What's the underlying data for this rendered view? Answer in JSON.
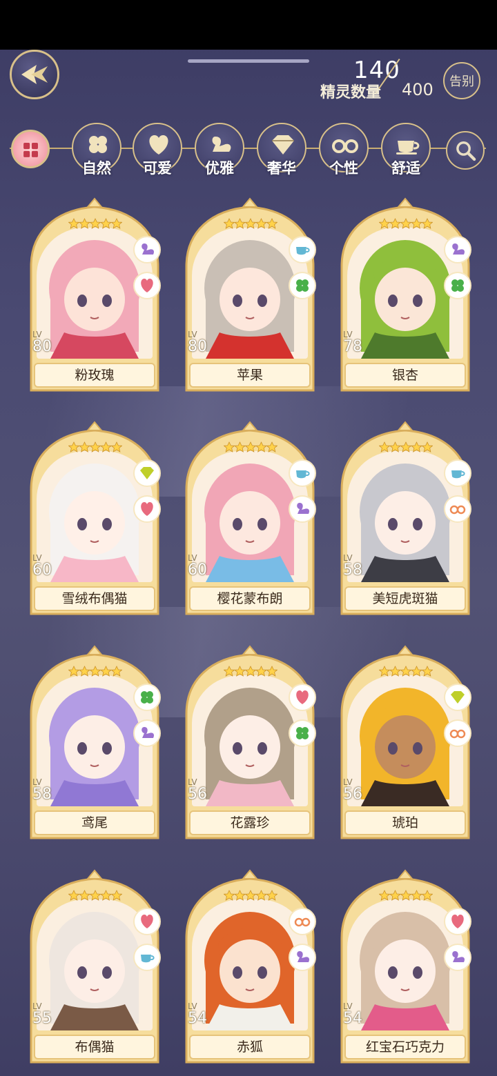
{
  "header": {
    "count_current": "140",
    "count_label": "精灵数量",
    "count_max": "400",
    "goodbye_label": "告别"
  },
  "filters": [
    {
      "key": "all",
      "label": "",
      "icon": "grid-icon"
    },
    {
      "key": "nature",
      "label": "自然",
      "icon": "clover-icon"
    },
    {
      "key": "cute",
      "label": "可爱",
      "icon": "heart-icon"
    },
    {
      "key": "elegant",
      "label": "优雅",
      "icon": "swan-icon"
    },
    {
      "key": "luxury",
      "label": "奢华",
      "icon": "diamond-icon"
    },
    {
      "key": "personality",
      "label": "个性",
      "icon": "glasses-icon"
    },
    {
      "key": "comfort",
      "label": "舒适",
      "icon": "teacup-icon"
    }
  ],
  "colors": {
    "accent_gold": "#d8c08a",
    "nature": "#49b04a",
    "cute": "#e86a7e",
    "elegant": "#9a71cf",
    "luxury": "#bfcf2a",
    "personality": "#ee8a55",
    "comfort": "#62b7d4"
  },
  "cards": [
    {
      "name": "粉玫瑰",
      "lv_tag": "LV",
      "level": "80",
      "badges": [
        "swan-icon",
        "heart-icon"
      ],
      "hair": "#f2a9b8",
      "skin": "#fde3d8",
      "outfit": "#d64860"
    },
    {
      "name": "苹果",
      "lv_tag": "LV",
      "level": "80",
      "badges": [
        "teacup-icon",
        "clover-icon"
      ],
      "hair": "#c9bfb5",
      "skin": "#fde7dc",
      "outfit": "#d4322e"
    },
    {
      "name": "银杏",
      "lv_tag": "LV",
      "level": "78",
      "badges": [
        "swan-icon",
        "clover-icon"
      ],
      "hair": "#8fbf3c",
      "skin": "#fbe6d7",
      "outfit": "#4e7a2c"
    },
    {
      "name": "雪绒布偶猫",
      "lv_tag": "LV",
      "level": "60",
      "badges": [
        "diamond-icon",
        "heart-icon"
      ],
      "hair": "#f5f2f0",
      "skin": "#fff0e8",
      "outfit": "#f7b7c7"
    },
    {
      "name": "樱花蒙布朗",
      "lv_tag": "LV",
      "level": "60",
      "badges": [
        "teacup-icon",
        "swan-icon"
      ],
      "hair": "#f1a6b6",
      "skin": "#fde8df",
      "outfit": "#79bce6"
    },
    {
      "name": "美短虎斑猫",
      "lv_tag": "LV",
      "level": "58",
      "badges": [
        "teacup-icon",
        "glasses-icon"
      ],
      "hair": "#c8c8ce",
      "skin": "#fdeee6",
      "outfit": "#3d3d45"
    },
    {
      "name": "鸢尾",
      "lv_tag": "LV",
      "level": "58",
      "badges": [
        "clover-icon",
        "swan-icon"
      ],
      "hair": "#b39ce4",
      "skin": "#fdeee6",
      "outfit": "#9078d4"
    },
    {
      "name": "花露珍",
      "lv_tag": "LV",
      "level": "56",
      "badges": [
        "heart-icon",
        "clover-icon"
      ],
      "hair": "#b1a08a",
      "skin": "#fdeee6",
      "outfit": "#f2b8c6"
    },
    {
      "name": "琥珀",
      "lv_tag": "LV",
      "level": "56",
      "badges": [
        "diamond-icon",
        "glasses-icon"
      ],
      "hair": "#f2b52a",
      "skin": "#c58d5c",
      "outfit": "#3a2b24"
    },
    {
      "name": "布偶猫",
      "lv_tag": "LV",
      "level": "55",
      "badges": [
        "heart-icon",
        "teacup-icon"
      ],
      "hair": "#eee6df",
      "skin": "#fdeee6",
      "outfit": "#7a5a46"
    },
    {
      "name": "赤狐",
      "lv_tag": "LV",
      "level": "54",
      "badges": [
        "glasses-icon",
        "swan-icon"
      ],
      "hair": "#e0652a",
      "skin": "#fbe2cf",
      "outfit": "#f2f0ea"
    },
    {
      "name": "红宝石巧克力",
      "lv_tag": "LV",
      "level": "54",
      "badges": [
        "heart-icon",
        "swan-icon"
      ],
      "hair": "#d8bfa8",
      "skin": "#fdeee6",
      "outfit": "#e35c8a"
    }
  ]
}
